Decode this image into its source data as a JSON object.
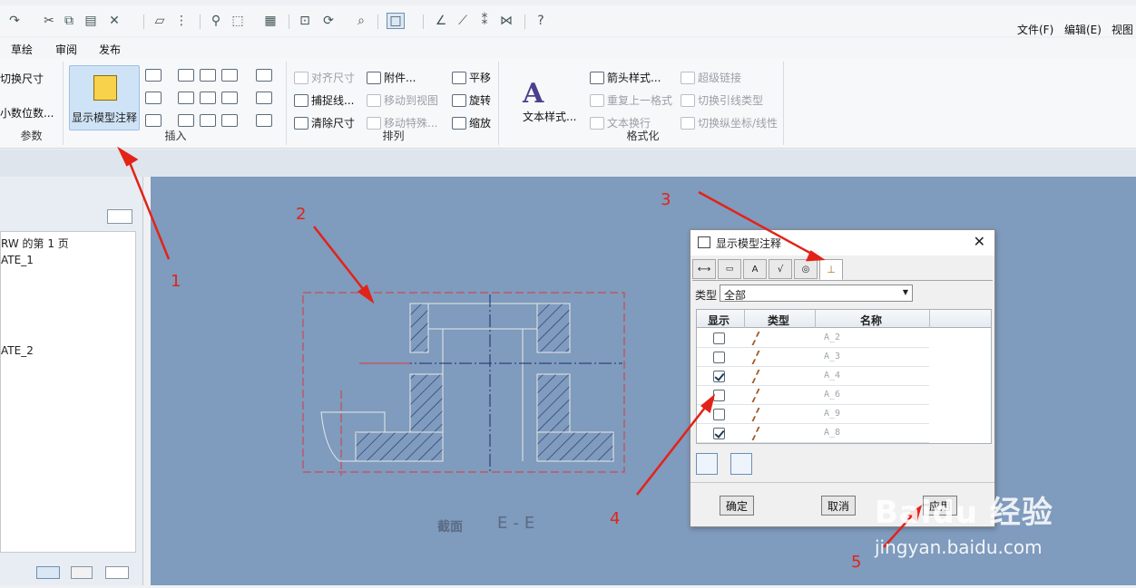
{
  "menu": {
    "file": "文件(F)",
    "edit": "编辑(E)",
    "view": "视图"
  },
  "tabs": [
    "草绘",
    "审阅",
    "发布"
  ],
  "ribbon": {
    "params": {
      "switch_dim": "切换尺寸",
      "decimals": "小数位数...",
      "label": "参数"
    },
    "insert": {
      "show_model_annotations": "显示模型注释",
      "label": "插入"
    },
    "arrange": {
      "align_dims": "对齐尺寸",
      "attach": "附件...",
      "move": "平移",
      "snap_line": "捕捉线...",
      "move_to_view": "移动到视图",
      "rotate": "旋转",
      "clear_dims": "清除尺寸",
      "move_special": "移动特殊...",
      "scale": "缩放",
      "label": "排列"
    },
    "format": {
      "text_style": "文本样式...",
      "arrow_style": "箭头样式...",
      "repeat_format": "重复上一格式",
      "text_wrap": "文本换行",
      "hyperlink": "超级链接",
      "toggle_leader": "切换引线类型",
      "toggle_ordinate": "切换纵坐标/线性",
      "label": "格式化"
    }
  },
  "tree": {
    "items": [
      "RW 的第 1 页",
      "ATE_1",
      "ATE_2"
    ]
  },
  "drawing": {
    "section_label": "截面",
    "section_name": "E-E"
  },
  "dialog": {
    "title": "显示模型注释",
    "type_label": "类型",
    "type_value": "全部",
    "columns": [
      "显示",
      "类型",
      "名称"
    ],
    "rows": [
      {
        "name": "A_2",
        "checked": false
      },
      {
        "name": "A_3",
        "checked": false
      },
      {
        "name": "A_4",
        "checked": true
      },
      {
        "name": "A_6",
        "checked": false
      },
      {
        "name": "A_9",
        "checked": false
      },
      {
        "name": "A_8",
        "checked": true
      }
    ],
    "ok": "确定",
    "cancel": "取消",
    "apply": "应用"
  },
  "markers": [
    "1",
    "2",
    "3",
    "4",
    "5"
  ],
  "watermark": {
    "brand": "Baidu 经验",
    "url": "jingyan.baidu.com"
  },
  "colors": {
    "canvas": "#7f9bbd",
    "annotation_red": "#e2231a",
    "hatch": "#1c2b6b"
  }
}
